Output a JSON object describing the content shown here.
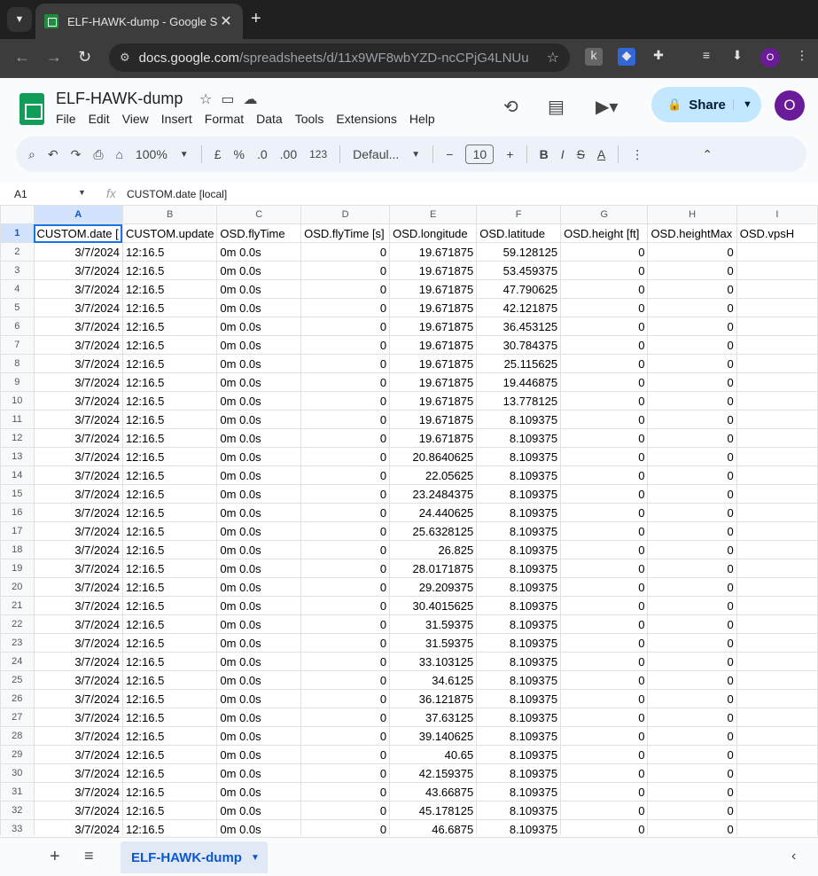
{
  "browser": {
    "tab_title": "ELF-HAWK-dump - Google Sh",
    "url_host": "docs.google.com",
    "url_path": "/spreadsheets/d/11x9WF8wbYZD-ncCPjG4LNUu..."
  },
  "doc": {
    "title": "ELF-HAWK-dump",
    "menu": [
      "File",
      "Edit",
      "View",
      "Insert",
      "Format",
      "Data",
      "Tools",
      "Extensions",
      "Help"
    ],
    "share_label": "Share",
    "avatar_letter": "O"
  },
  "toolbar": {
    "zoom": "100%",
    "currency": "£",
    "percent": "%",
    "dec_decrease": ".0",
    "dec_increase": ".00",
    "number_format": "123",
    "font": "Defaul...",
    "font_size": "10",
    "bold": "B",
    "italic": "I",
    "strike": "S",
    "text_color": "A"
  },
  "formula_bar": {
    "cell": "A1",
    "fx": "fx",
    "value": "CUSTOM.date [local]"
  },
  "columns": [
    "A",
    "B",
    "C",
    "D",
    "E",
    "F",
    "G",
    "H",
    "I"
  ],
  "header_row": [
    "CUSTOM.date [",
    "CUSTOM.update",
    "OSD.flyTime",
    "OSD.flyTime [s]",
    "OSD.longitude",
    "OSD.latitude",
    "OSD.height [ft]",
    "OSD.heightMax",
    "OSD.vpsH"
  ],
  "row_date": "3/7/2024",
  "row_time": "12:16.5",
  "row_fly": "0m 0.0s",
  "rows": [
    [
      "19.671875",
      "59.128125"
    ],
    [
      "19.671875",
      "53.459375"
    ],
    [
      "19.671875",
      "47.790625"
    ],
    [
      "19.671875",
      "42.121875"
    ],
    [
      "19.671875",
      "36.453125"
    ],
    [
      "19.671875",
      "30.784375"
    ],
    [
      "19.671875",
      "25.115625"
    ],
    [
      "19.671875",
      "19.446875"
    ],
    [
      "19.671875",
      "13.778125"
    ],
    [
      "19.671875",
      "8.109375"
    ],
    [
      "19.671875",
      "8.109375"
    ],
    [
      "20.8640625",
      "8.109375"
    ],
    [
      "22.05625",
      "8.109375"
    ],
    [
      "23.2484375",
      "8.109375"
    ],
    [
      "24.440625",
      "8.109375"
    ],
    [
      "25.6328125",
      "8.109375"
    ],
    [
      "26.825",
      "8.109375"
    ],
    [
      "28.0171875",
      "8.109375"
    ],
    [
      "29.209375",
      "8.109375"
    ],
    [
      "30.4015625",
      "8.109375"
    ],
    [
      "31.59375",
      "8.109375"
    ],
    [
      "31.59375",
      "8.109375"
    ],
    [
      "33.103125",
      "8.109375"
    ],
    [
      "34.6125",
      "8.109375"
    ],
    [
      "36.121875",
      "8.109375"
    ],
    [
      "37.63125",
      "8.109375"
    ],
    [
      "39.140625",
      "8.109375"
    ],
    [
      "40.65",
      "8.109375"
    ],
    [
      "42.159375",
      "8.109375"
    ],
    [
      "43.66875",
      "8.109375"
    ],
    [
      "45.178125",
      "8.109375"
    ],
    [
      "46.6875",
      "8.109375"
    ]
  ],
  "zero": "0",
  "sheet_tab": "ELF-HAWK-dump"
}
